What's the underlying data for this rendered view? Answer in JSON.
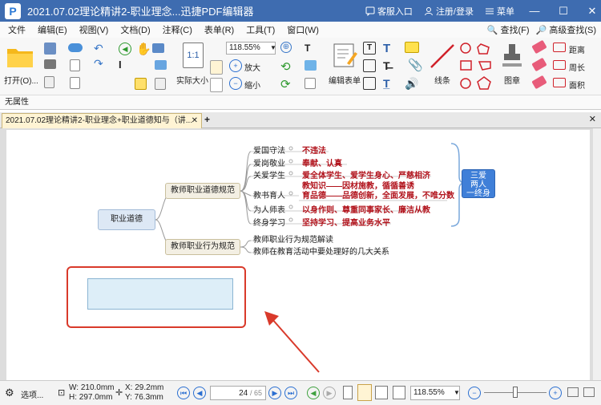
{
  "titlebar": {
    "logo": "P",
    "title": "2021.07.02理论精讲2-职业理念...迅捷PDF编辑器",
    "customer": "客服入口",
    "login": "注册/登录",
    "menu": "菜单",
    "minimize": "—",
    "maximize": "☐",
    "close": "✕"
  },
  "menubar": {
    "items": [
      "文件",
      "编辑(E)",
      "视图(V)",
      "文档(D)",
      "注释(C)",
      "表单(R)",
      "工具(T)",
      "窗口(W)"
    ],
    "find": "查找(F)",
    "advanced_find": "高级查找(S)"
  },
  "toolbar": {
    "open": "打开(O)...",
    "actual_size_icon": "1:1",
    "actual_size": "实际大小",
    "zoom_value": "118.55%",
    "zoom_in": "放大",
    "zoom_out": "缩小",
    "edit_form": "编辑表单",
    "line": "线条",
    "stamp": "图章",
    "distance": "距离",
    "perimeter": "周长",
    "area": "面积"
  },
  "propbar": {
    "text": "无属性"
  },
  "tabs": {
    "doc_tab": "2021.07.02理论精讲2-职业理念+职业道德知与（讲...",
    "close": "✕",
    "add": "+",
    "close_all": "✕"
  },
  "mindmap": {
    "root": "职业道德",
    "branch1": "教师职业道德规范",
    "branch2": "教师职业行为规范",
    "items": [
      {
        "label": "爱国守法",
        "desc": "不违法"
      },
      {
        "label": "爱岗敬业",
        "desc": "奉献、认真"
      },
      {
        "label": "关爱学生",
        "desc": "爱全体学生、爱学生身心、严慈相济"
      },
      {
        "label": "教书育人",
        "desc": "教知识——因材施教，循循善诱\n育品德——品德创新，全面发展，不唯分数"
      },
      {
        "label": "为人师表",
        "desc": "以身作则、尊重同事家长、廉洁从教"
      },
      {
        "label": "终身学习",
        "desc": "坚持学习、提高业务水平"
      }
    ],
    "sub2": [
      "教师职业行为规范解读",
      "教师在教育活动中要处理好的几大关系"
    ],
    "summary": "三爱\n两人\n一终身"
  },
  "statusbar": {
    "options": "选项...",
    "width": "W: 210.0mm",
    "height": "H: 297.0mm",
    "x": "X:    29.2mm",
    "y": "Y:    76.3mm",
    "page_current": "24",
    "page_total": "/ 65",
    "zoom": "118.55%"
  },
  "colors": {
    "titlebar": "#3e6cb0",
    "annotation_red": "#d93a2b",
    "text_red": "#b1121b",
    "summary_blue": "#3f7fd8"
  }
}
